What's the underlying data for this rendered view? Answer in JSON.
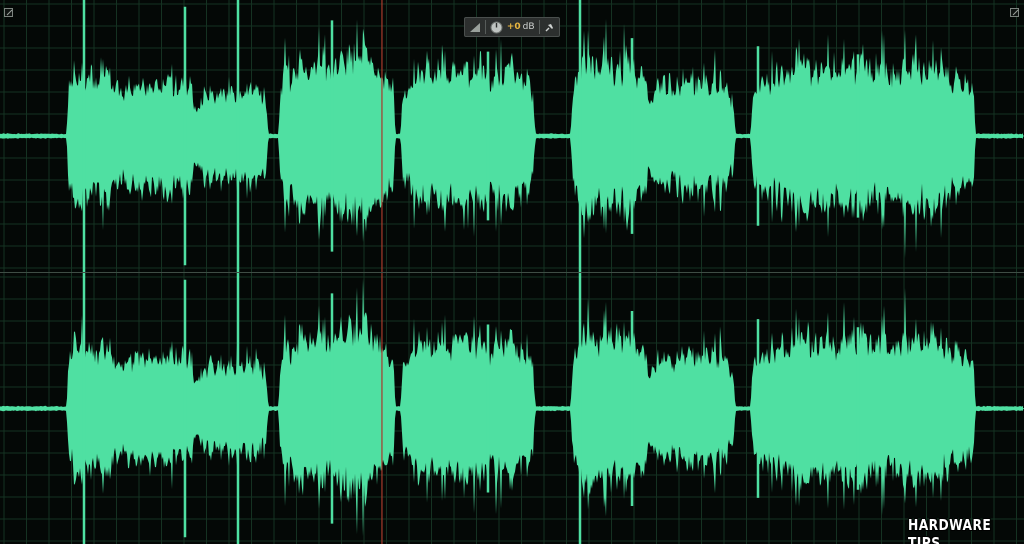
{
  "app": {
    "view": "waveform-editor",
    "channels": [
      "left",
      "right"
    ]
  },
  "hud": {
    "gain_value": "+0",
    "gain_unit": "dB",
    "icons": [
      "volume-ramp-icon",
      "gain-knob-icon",
      "pin-icon"
    ]
  },
  "colors": {
    "background": "#040806",
    "waveform": "#4fe0a2",
    "grid": "#153222",
    "playhead": "#a83a2c",
    "divider": "#3f4d45",
    "gain_text": "#e8b640"
  },
  "watermark": {
    "text": "HARDWARE TIPS"
  },
  "playhead": {
    "position_fraction": 0.373
  }
}
